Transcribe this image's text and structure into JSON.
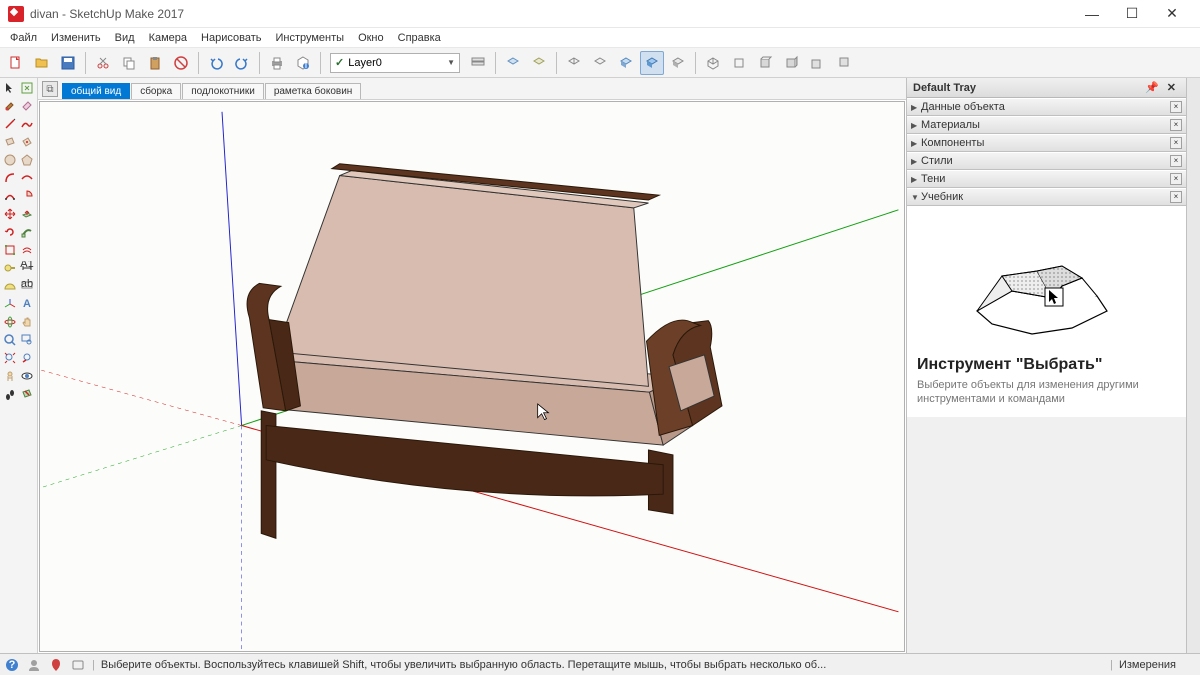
{
  "title": "divan - SketchUp Make 2017",
  "menu": [
    "Файл",
    "Изменить",
    "Вид",
    "Камера",
    "Нарисовать",
    "Инструменты",
    "Окно",
    "Справка"
  ],
  "layer": "Layer0",
  "scenes": {
    "active": "общий вид",
    "others": [
      "сборка",
      "подлокотники",
      "раметка боковин"
    ]
  },
  "tray": {
    "title": "Default Tray",
    "panels": [
      "Данные объекта",
      "Материалы",
      "Компоненты",
      "Стили",
      "Тени"
    ],
    "open_panel": "Учебник",
    "instructor": {
      "title": "Инструмент \"Выбрать\"",
      "text": "Выберите объекты для изменения другими инструментами и командами"
    }
  },
  "status": {
    "hint": "Выберите объекты. Воспользуйтесь клавишей Shift, чтобы увеличить выбранную область. Перетащите мышь, чтобы выбрать несколько об...",
    "right": "Измерения"
  }
}
